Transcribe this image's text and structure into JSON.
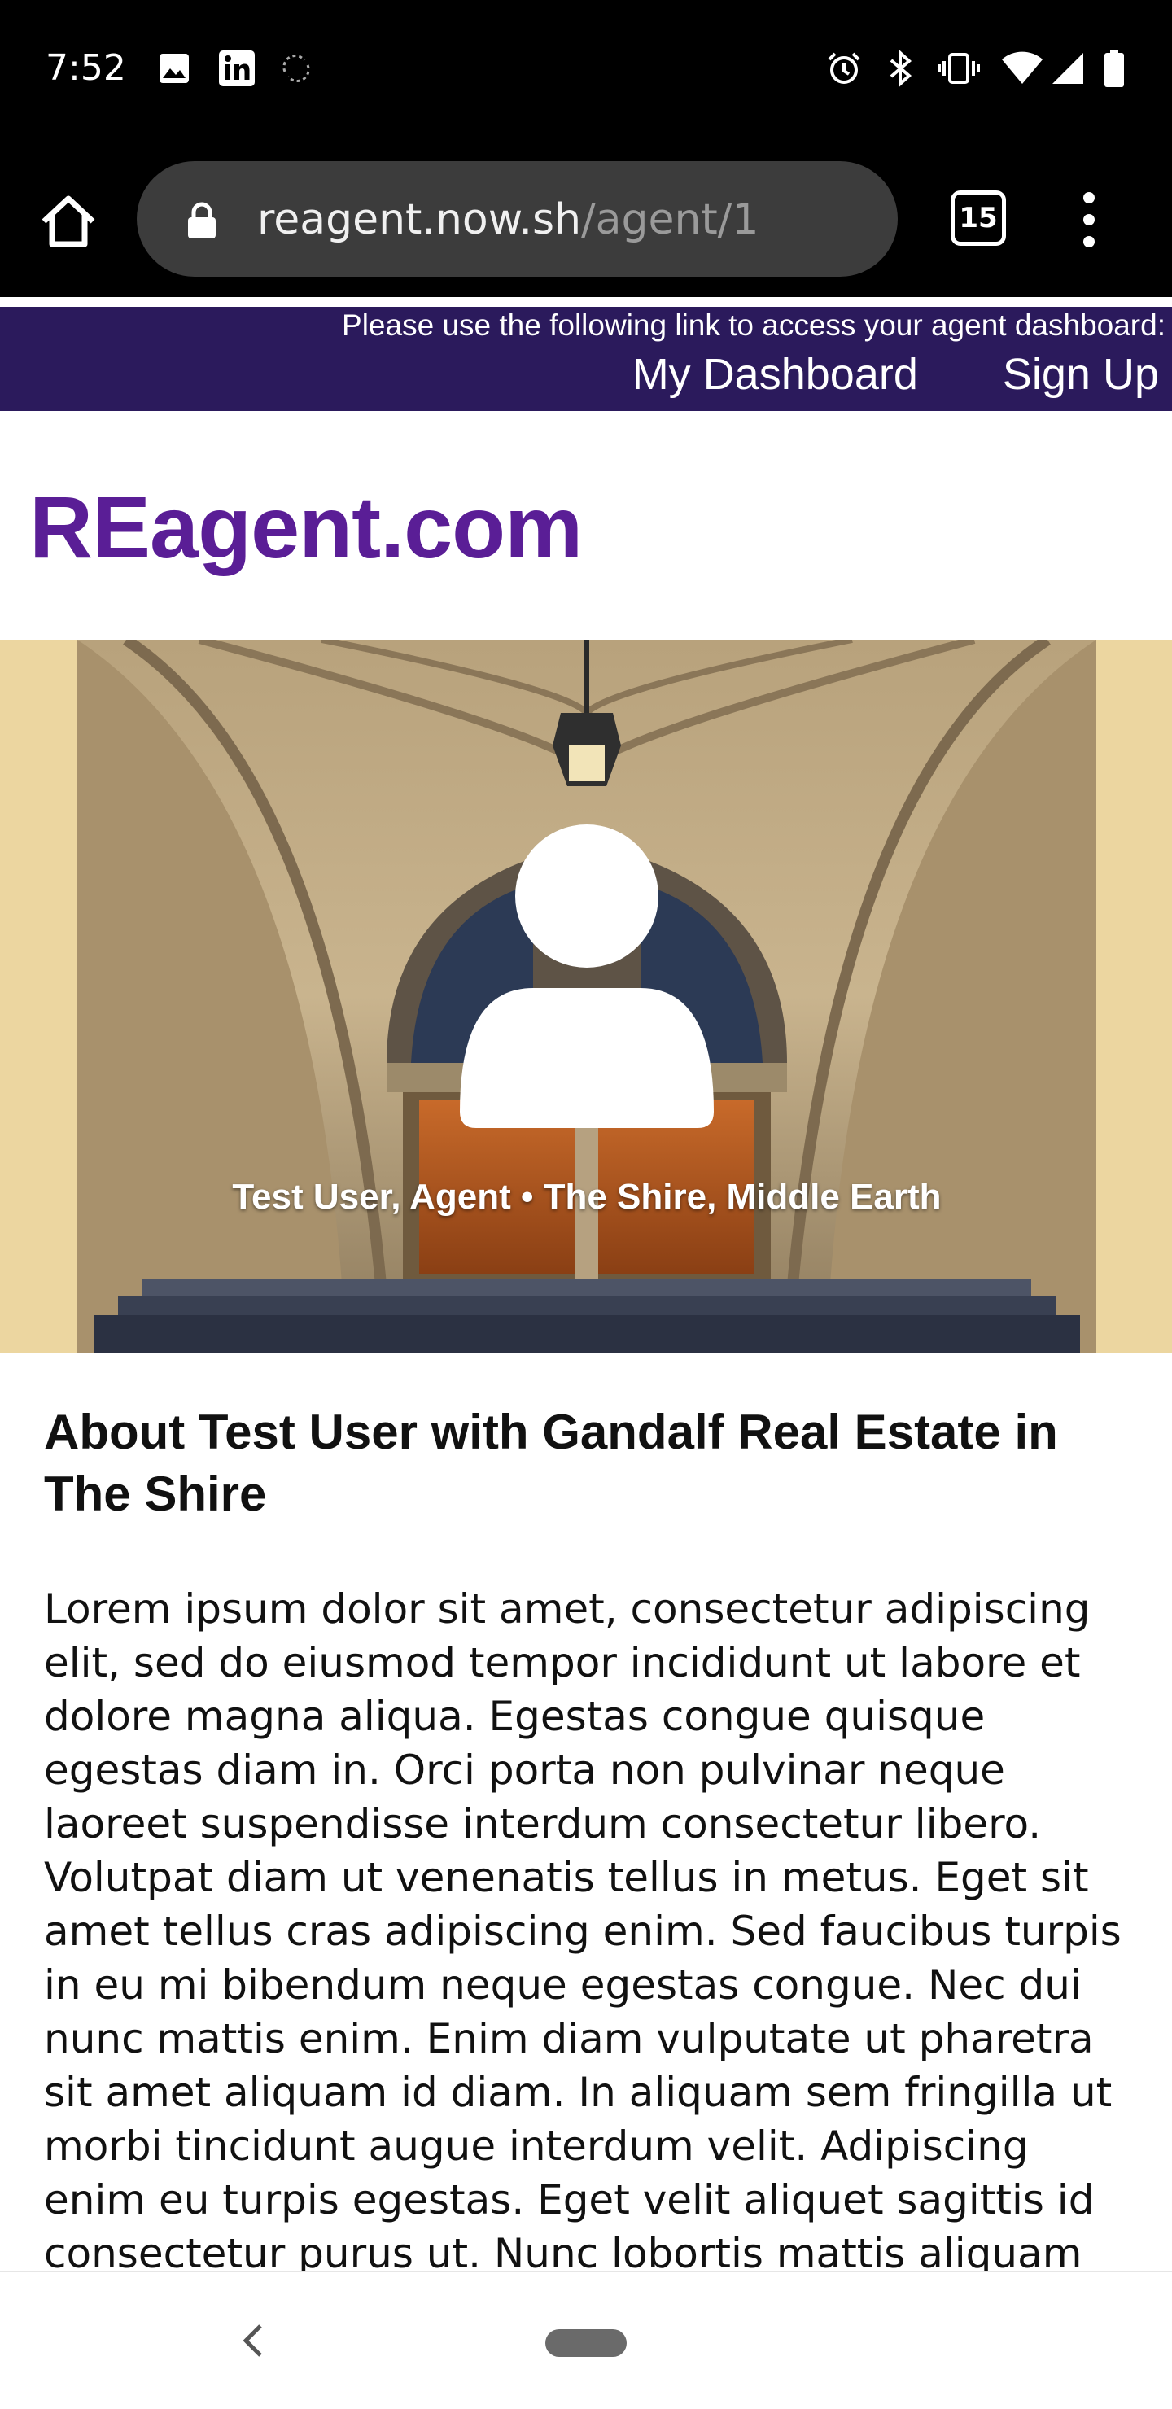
{
  "status_bar": {
    "time": "7:52",
    "icons": [
      "image-icon",
      "linkedin-icon",
      "sync-icon",
      "alarm-icon",
      "bluetooth-icon",
      "vibrate-icon",
      "wifi-icon",
      "signal-icon",
      "battery-icon"
    ]
  },
  "browser": {
    "url_host": "reagent.now.sh",
    "url_path": "/agent/1",
    "tab_count": "15"
  },
  "top_strip": {
    "note": "Please use the following link to access your agent dashboard:",
    "links": [
      "My Dashboard",
      "Sign Up"
    ],
    "background": "#2b1a5c"
  },
  "site": {
    "logo": "REagent.com",
    "logo_color": "#5a1e96"
  },
  "hero": {
    "caption": "Test User, Agent • The Shire, Middle Earth",
    "background": "#ecd6a0"
  },
  "about": {
    "title": "About Test User with Gandalf Real Estate in The Shire",
    "body": "Lorem ipsum dolor sit amet, consectetur adipiscing elit, sed do eiusmod tempor incididunt ut labore et dolore magna aliqua. Egestas congue quisque egestas diam in. Orci porta non pulvinar neque laoreet suspendisse interdum consectetur libero. Volutpat diam ut venenatis tellus in metus. Eget sit amet tellus cras adipiscing enim. Sed faucibus turpis in eu mi bibendum neque egestas congue. Nec dui nunc mattis enim. Enim diam vulputate ut pharetra sit amet aliquam id diam. In aliquam sem fringilla ut morbi tincidunt augue interdum velit. Adipiscing enim eu turpis egestas. Eget velit aliquet sagittis id consectetur purus ut. Nunc lobortis mattis aliquam"
  }
}
